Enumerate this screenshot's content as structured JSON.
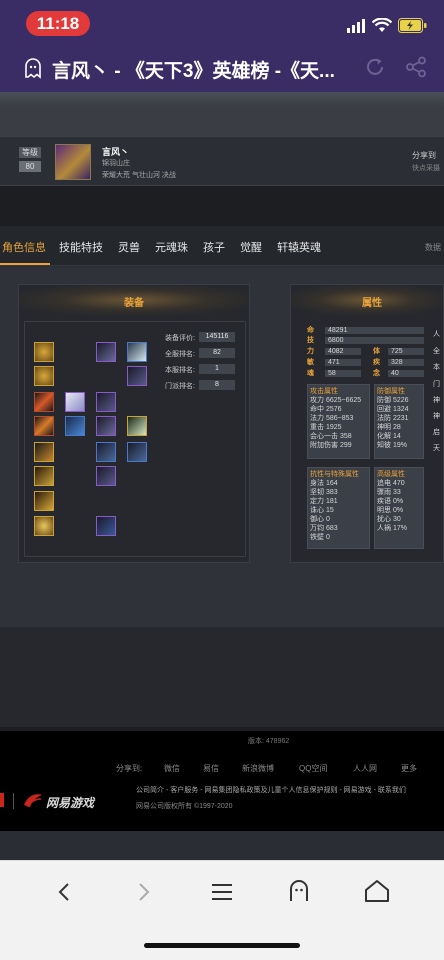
{
  "status_bar": {
    "time": "11:18"
  },
  "nav": {
    "title": "言风丶 - 《天下3》英雄榜 -《天..."
  },
  "profile": {
    "level_label": "等级",
    "level": "80",
    "name": "言风丶",
    "school": "锦羽山庄",
    "titles": "荣耀大荒 气壮山河 决战",
    "share_label": "分享到",
    "share_sub": "快点采摄"
  },
  "tabs": [
    "角色信息",
    "技能特技",
    "灵兽",
    "元魂珠",
    "孩子",
    "觉醒",
    "轩辕英魂"
  ],
  "tabs_right": "数据",
  "equipment": {
    "title": "装备",
    "score_label": "装备评价:",
    "score": "145116",
    "server_rank_label": "全服排名:",
    "server_rank": "82",
    "local_rank_label": "本服排名:",
    "local_rank": "1",
    "school_rank_label": "门派排名:",
    "school_rank": "8"
  },
  "attributes": {
    "title": "属性",
    "bars": [
      {
        "label": "命",
        "value": "48291"
      },
      {
        "label": "技",
        "value": "6800"
      }
    ],
    "pairs": [
      {
        "l1": "力",
        "v1": "4082",
        "l2": "体",
        "v2": "725"
      },
      {
        "l1": "敏",
        "v1": "471",
        "l2": "疾",
        "v2": "328"
      },
      {
        "l1": "魂",
        "v1": "58",
        "l2": "念",
        "v2": "40"
      }
    ],
    "attack": {
      "title": "攻击属性",
      "lines": [
        "攻力 6625~6625",
        "命中 2576",
        "法力 586~853",
        "重击 1925",
        "会心一击 358",
        "附加伤害 299"
      ]
    },
    "defense": {
      "title": "防御属性",
      "lines": [
        "防御 5226",
        "回避 1324",
        "法防 2231",
        "神明 28",
        "化解 14",
        "知彼 19%"
      ]
    },
    "resist": {
      "title": "抗性与特殊属性",
      "lines": [
        "身法 164",
        "坚韧 383",
        "定力 181",
        "诛心 15",
        "御心 0",
        "万钧 683",
        "铁壁 0"
      ]
    },
    "advanced": {
      "title": "高级属性",
      "lines": [
        "追电 470",
        "骤雨 33",
        "疾语 0%",
        "明思 0%",
        "扰心 30",
        "人祸 17%"
      ]
    },
    "right_edge": [
      "人",
      "全",
      "本",
      "门",
      "神",
      "神",
      "启",
      "天"
    ]
  },
  "footer": {
    "version": "版本: 478962",
    "share_to": "分享到:",
    "links": [
      "微信",
      "易信",
      "新浪微博",
      "QQ空间",
      "人人网",
      "更多"
    ],
    "brand": "网易游戏",
    "legal": "公司简介 - 客户服务 - 网易集团隐私政策及儿童个人信息保护规则 - 网易游戏 - 联系我们",
    "copyright": "网易公司版权所有 ©1997-2020"
  },
  "colors": {
    "accent": "#e8a33a",
    "navbar": "#3a2d66",
    "clock_bg": "#e23a3a"
  }
}
